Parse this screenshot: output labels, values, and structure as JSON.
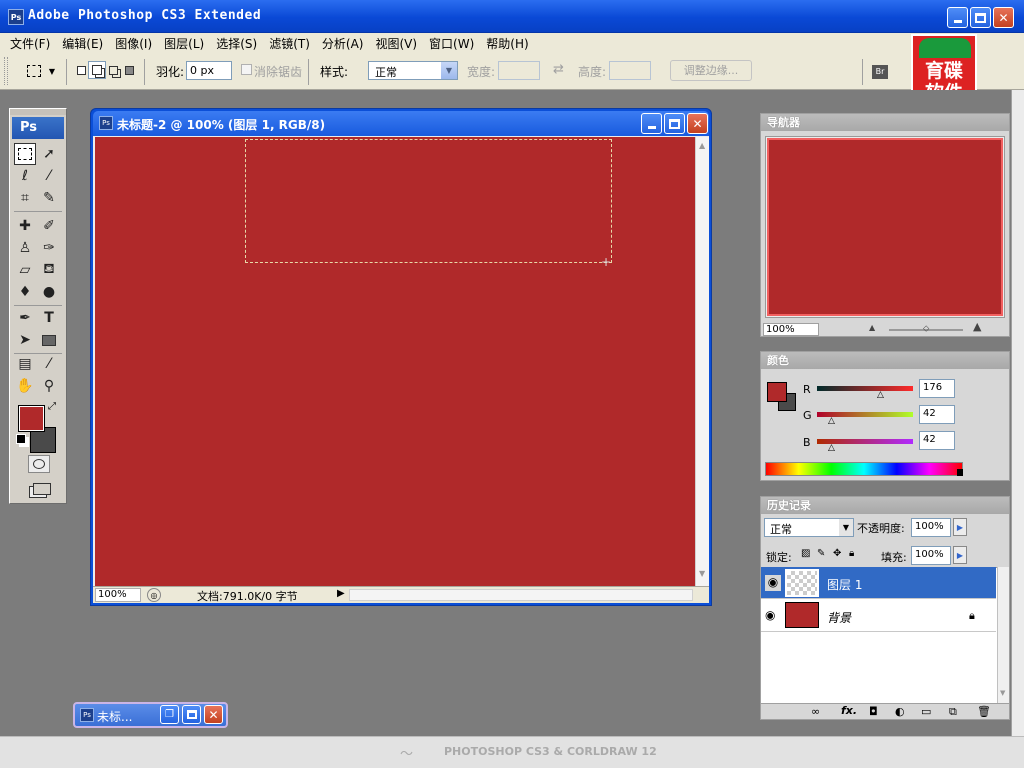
{
  "app": {
    "title": "Adobe Photoshop CS3 Extended",
    "ps_badge": "Ps"
  },
  "menu": [
    "文件(F)",
    "编辑(E)",
    "图像(I)",
    "图层(L)",
    "选择(S)",
    "滤镜(T)",
    "分析(A)",
    "视图(V)",
    "窗口(W)",
    "帮助(H)"
  ],
  "options": {
    "feather_label": "羽化:",
    "feather_value": "0 px",
    "antialias_label": "消除锯齿",
    "style_label": "样式:",
    "style_value": "正常",
    "width_label": "宽度:",
    "height_label": "高度:",
    "refine_edge": "调整边缘..."
  },
  "logo": {
    "line1": "育碟",
    "line2": "软件"
  },
  "toolbox": {
    "header": "Ps",
    "foreground_color": "#b0292a",
    "background_color": "#4a4a4a"
  },
  "document": {
    "title": "未标题-2 @ 100% (图层 1, RGB/8)",
    "canvas_color": "#b0292a",
    "zoom": "100%",
    "doc_info": "文档:791.0K/0 字节"
  },
  "navigator": {
    "title": "导航器",
    "zoom": "100%"
  },
  "color_panel": {
    "title": "颜色",
    "channels": [
      {
        "label": "R",
        "value": "176"
      },
      {
        "label": "G",
        "value": "42"
      },
      {
        "label": "B",
        "value": "42"
      }
    ]
  },
  "layers_panel": {
    "title": "历史记录",
    "blend_mode": "正常",
    "opacity_label": "不透明度:",
    "opacity_value": "100%",
    "lock_label": "锁定:",
    "fill_label": "填充:",
    "fill_value": "100%",
    "layers": [
      {
        "name": "图层 1",
        "selected": true
      },
      {
        "name": "背景",
        "selected": false
      }
    ]
  },
  "minimized_doc": {
    "title": "未标..."
  },
  "brand_footer": "PHOTOSHOP CS3 & CORLDRAW 12"
}
